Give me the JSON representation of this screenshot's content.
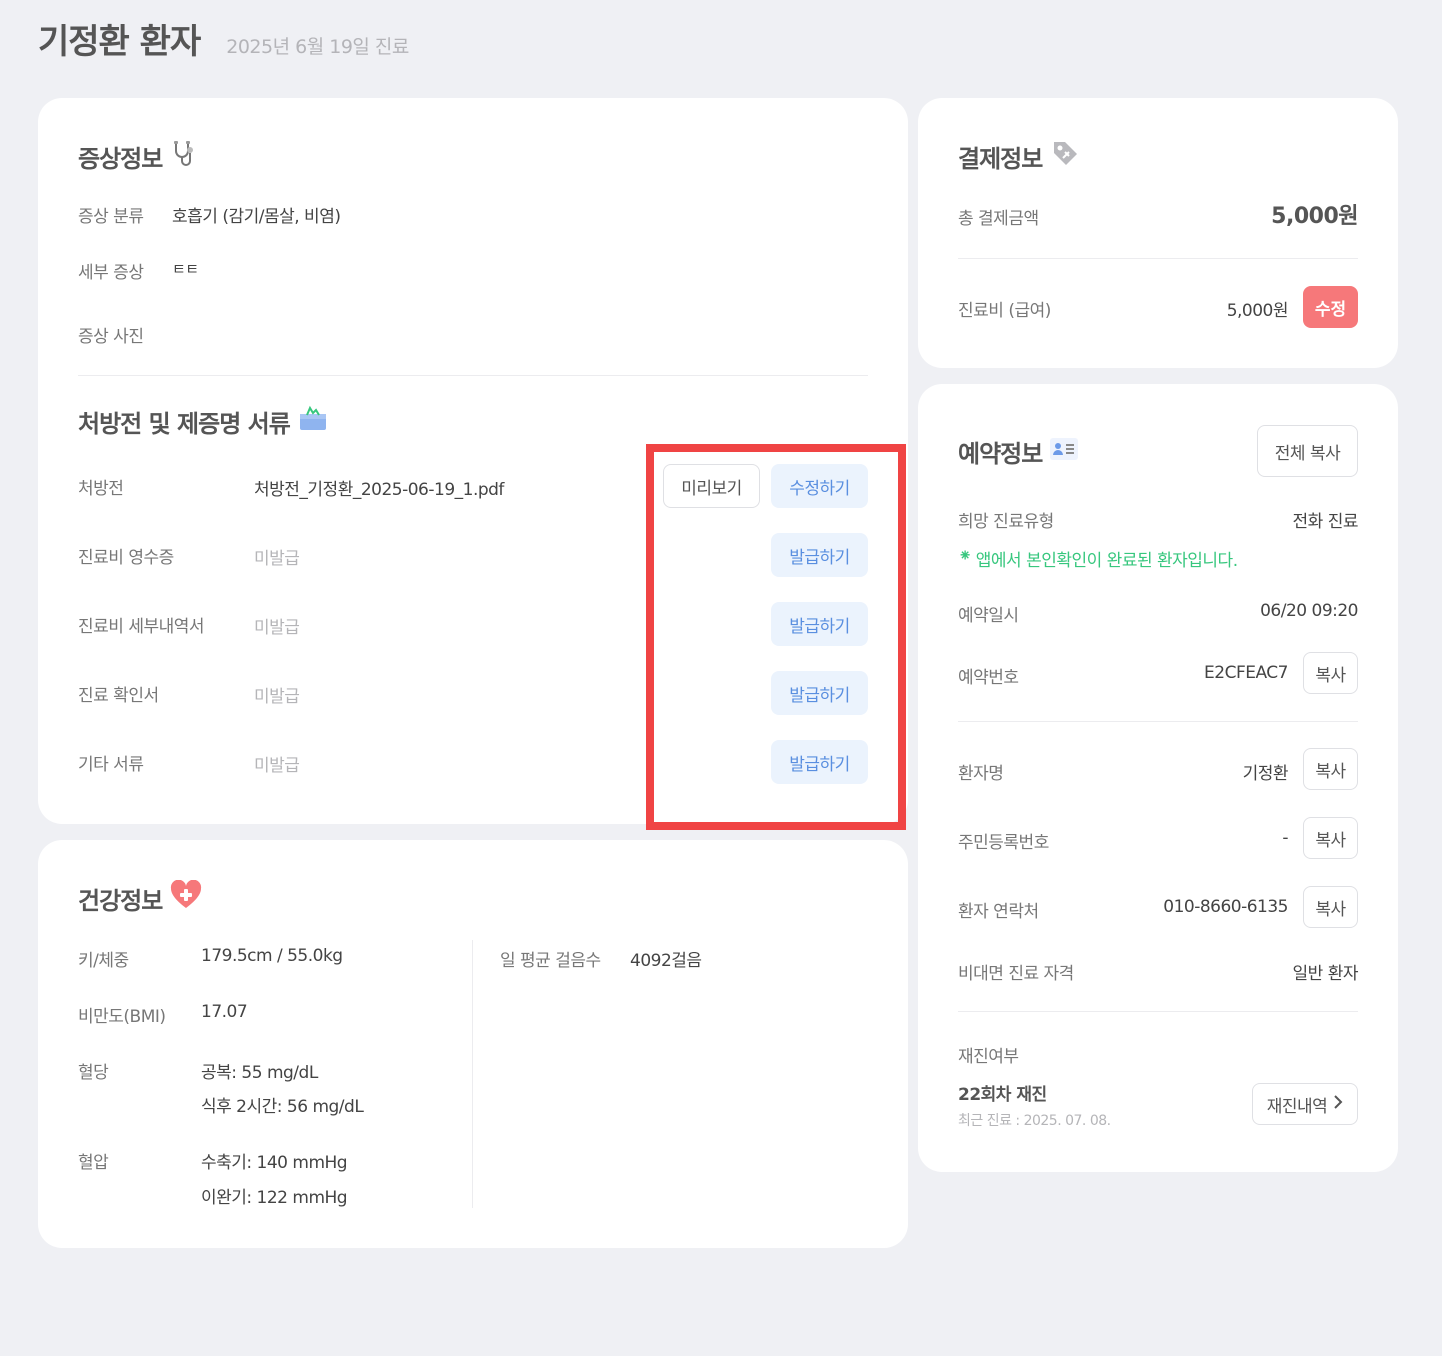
{
  "header": {
    "title": "기정환 환자",
    "subtitle": "2025년 6월 19일 진료"
  },
  "symptoms": {
    "title": "증상정보",
    "category_label": "증상 분류",
    "category_value": "호흡기 (감기/몸살, 비염)",
    "detail_label": "세부 증상",
    "detail_value": "ㅌㅌ",
    "photo_label": "증상 사진"
  },
  "documents": {
    "title": "처방전 및 제증명 서류",
    "items": [
      {
        "label": "처방전",
        "value": "처방전_기정환_2025-06-19_1.pdf",
        "action": "수정하기",
        "preview": "미리보기"
      },
      {
        "label": "진료비 영수증",
        "value": "미발급",
        "action": "발급하기"
      },
      {
        "label": "진료비 세부내역서",
        "value": "미발급",
        "action": "발급하기"
      },
      {
        "label": "진료 확인서",
        "value": "미발급",
        "action": "발급하기"
      },
      {
        "label": "기타 서류",
        "value": "미발급",
        "action": "발급하기"
      }
    ]
  },
  "health": {
    "title": "건강정보",
    "height_weight_label": "키/체중",
    "height_weight_value": "179.5cm / 55.0kg",
    "bmi_label": "비만도(BMI)",
    "bmi_value": "17.07",
    "glucose_label": "혈당",
    "glucose_fasting": "공복: 55 mg/dL",
    "glucose_after": "식후 2시간: 56 mg/dL",
    "bp_label": "혈압",
    "bp_systolic": "수축기: 140 mmHg",
    "bp_diastolic": "이완기: 122 mmHg",
    "steps_label": "일 평균 걸음수",
    "steps_value": "4092걸음"
  },
  "payment": {
    "title": "결제정보",
    "total_label": "총 결제금액",
    "total_value": "5,000원",
    "fee_label": "진료비 (급여)",
    "fee_value": "5,000원",
    "edit_label": "수정"
  },
  "reservation": {
    "title": "예약정보",
    "copy_all_label": "전체 복사",
    "type_label": "희망 진료유형",
    "type_value": "전화 진료",
    "verified_notice": "앱에서 본인확인이 완료된 환자입니다.",
    "verified_mark": "⁕",
    "datetime_label": "예약일시",
    "datetime_value": "06/20 09:20",
    "number_label": "예약번호",
    "number_value": "E2CFEAC7",
    "copy_label": "복사",
    "name_label": "환자명",
    "name_value": "기정환",
    "rrn_label": "주민등록번호",
    "rrn_value": "-",
    "phone_label": "환자 연락처",
    "phone_value": "010-8660-6135",
    "eligibility_label": "비대면 진료 자격",
    "eligibility_value": "일반 환자",
    "revisit_label": "재진여부",
    "revisit_value": "22회차 재진",
    "last_visit": "최근 진료 : 2025. 07. 08.",
    "history_label": "재진내역"
  },
  "icons": {
    "stethoscope": "stethoscope-icon",
    "documents": "document-box-icon",
    "health": "heart-plus-icon",
    "payment": "price-tag-icon",
    "reservation": "contact-card-icon",
    "chevron": "chevron-right-icon"
  },
  "colors": {
    "accent_blue": "#5a8fe0",
    "accent_red": "#f6787a",
    "highlight": "#f04444",
    "verified_green": "#37c77e"
  }
}
